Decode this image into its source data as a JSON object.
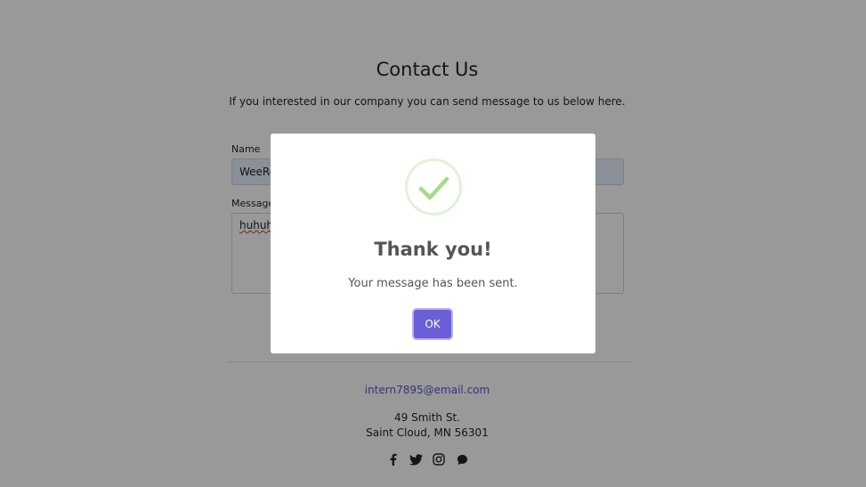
{
  "page": {
    "title": "Contact Us",
    "subtitle": "If you interested in our company you can send message to us below here."
  },
  "form": {
    "name_label": "Name",
    "name_value": "WeeRo",
    "message_label": "Message",
    "message_value": "huhuhu"
  },
  "footer": {
    "email": "intern7895@email.com",
    "address_line1": "49 Smith St.",
    "address_line2": "Saint Cloud, MN 56301",
    "socials": [
      "facebook-icon",
      "twitter-icon",
      "instagram-icon",
      "chat-icon"
    ]
  },
  "modal": {
    "icon": "success-check-icon",
    "title": "Thank you!",
    "text": "Your message has been sent.",
    "ok_label": "OK"
  },
  "colors": {
    "accent": "#6a5ed9",
    "link": "#5a52d5",
    "success": "#a5dc86",
    "overlay": "rgba(0,0,0,0.4)"
  }
}
